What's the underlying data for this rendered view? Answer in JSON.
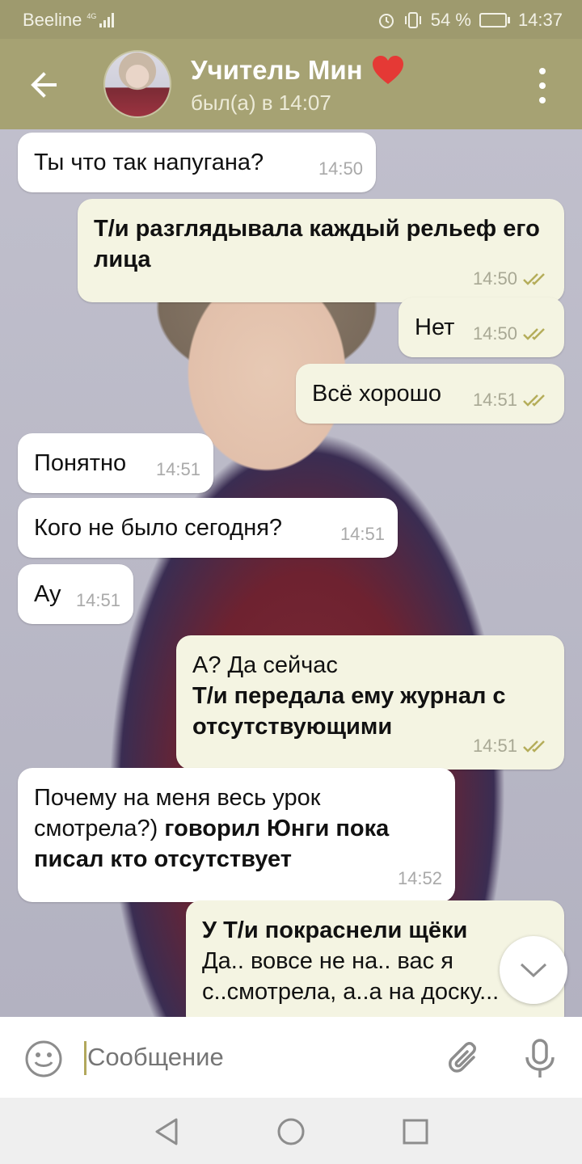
{
  "status_bar": {
    "carrier": "Beeline",
    "network": "4G",
    "battery": "54 %",
    "battery_level": 0.54,
    "time": "14:37"
  },
  "header": {
    "title": "Учитель Мин",
    "title_emoji": "❤️",
    "subtitle": "был(а) в 14:07"
  },
  "messages": [
    {
      "dir": "in",
      "parts": [
        {
          "t": "Ты что так напугана?",
          "b": false
        }
      ],
      "time": "14:50"
    },
    {
      "dir": "out",
      "parts": [
        {
          "t": "Т/и разглядывала каждый рельеф его лица",
          "b": true
        }
      ],
      "time": "14:50",
      "read": true
    },
    {
      "dir": "out",
      "parts": [
        {
          "t": "Нет",
          "b": false
        }
      ],
      "time": "14:50",
      "read": true
    },
    {
      "dir": "out",
      "parts": [
        {
          "t": "Всё хорошо",
          "b": false
        }
      ],
      "time": "14:51",
      "read": true
    },
    {
      "dir": "in",
      "parts": [
        {
          "t": "Понятно",
          "b": false
        }
      ],
      "time": "14:51"
    },
    {
      "dir": "in",
      "parts": [
        {
          "t": "Кого не было сегодня?",
          "b": false
        }
      ],
      "time": "14:51"
    },
    {
      "dir": "in",
      "parts": [
        {
          "t": "Ау",
          "b": false
        }
      ],
      "time": "14:51"
    },
    {
      "dir": "out",
      "parts": [
        {
          "t": "А? Да сейчас",
          "b": false
        },
        {
          "t": "Т/и передала ему журнал с отсутствующими",
          "b": true
        }
      ],
      "time": "14:51",
      "read": true
    },
    {
      "dir": "in",
      "parts": [
        {
          "t": "Почему на меня весь урок смотрела?) ",
          "b": false
        },
        {
          "t": "говорил Юнги пока писал кто отсутствует",
          "b": true
        }
      ],
      "time": "14:52"
    },
    {
      "dir": "out",
      "parts": [
        {
          "t": "У Т/и покраснели щёки",
          "b": true
        },
        {
          "t": "Да.. вовсе не на.. вас я с..смотрела, а..а на доску...",
          "b": false
        }
      ],
      "time": ""
    }
  ],
  "input": {
    "placeholder": "Сообщение"
  },
  "icons": {
    "back": "arrow-left-icon",
    "menu": "more-vert-icon",
    "emoji": "smiley-icon",
    "attach": "paperclip-icon",
    "mic": "microphone-icon",
    "scroll": "chevron-down-icon"
  },
  "colors": {
    "header": "#a6a273",
    "statusbar": "#9e9a6e",
    "bubble_out": "#f4f4e2",
    "bubble_in": "#ffffff",
    "ticks": "#b5ad5a"
  }
}
